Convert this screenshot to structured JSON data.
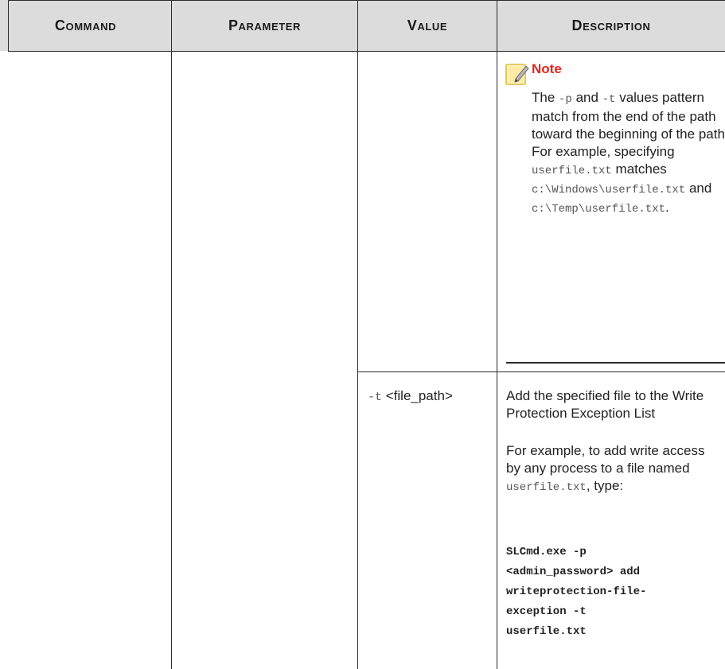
{
  "table": {
    "headers": {
      "command": "Command",
      "parameter": "Parameter",
      "value": "Value",
      "description": "Description"
    },
    "note": {
      "title": "Note",
      "t1": "The ",
      "c1": "-p",
      "t2": " and ",
      "c2": "-t",
      "t3": " values pattern match from the end of the path toward the beginning of the path. For example, specifying ",
      "c3": "userfile.txt",
      "t4": " matches ",
      "c4": "c:\\Windows\\userfile.txt",
      "t5": " and ",
      "c5": "c:\\Temp\\userfile.txt",
      "t6": "."
    },
    "row": {
      "value_flag": "-t",
      "value_arg": " <file_path>",
      "desc1": "Add the specified file to the Write Protection Exception List",
      "desc2_a": "For example, to add write access by any process to a file named ",
      "desc2_code": "userfile.txt",
      "desc2_b": ", type:",
      "code_lines": [
        "SLCmd.exe -p",
        "<admin_password> add",
        "writeprotection-file-",
        "exception -t",
        "userfile.txt"
      ]
    }
  }
}
